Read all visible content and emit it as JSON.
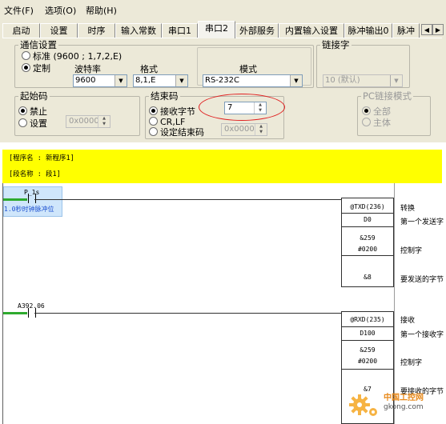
{
  "menubar": {
    "items": [
      "文件(F)",
      "选项(O)",
      "帮助(H)"
    ]
  },
  "tabs": [
    "启动",
    "设置",
    "时序",
    "输入常数",
    "串口1",
    "串口2",
    "外部服务",
    "内置输入设置",
    "脉冲输出0",
    "脉冲"
  ],
  "active_tab": "串口2",
  "comm": {
    "group_label": "通信设置",
    "standard_label": "标准 (9600 ; 1,7,2,E)",
    "custom_label": "定制",
    "baud_label": "波特率",
    "baud_value": "9600",
    "format_label": "格式",
    "format_value": "8,1,E",
    "mode_label": "模式",
    "mode_value": "RS-232C"
  },
  "link": {
    "group_label": "链接字",
    "value": "10 (默认)"
  },
  "start_code": {
    "group_label": "起始码",
    "disable_label": "禁止",
    "set_label": "设置",
    "value": "0x0000"
  },
  "end_code": {
    "group_label": "结束码",
    "recv_bytes_label": "接收字节",
    "recv_bytes_value": "7",
    "crlf_label": "CR,LF",
    "set_end_label": "设定结束码",
    "set_end_value": "0x0000"
  },
  "pc_link": {
    "group_label": "PC链接模式",
    "all_label": "全部",
    "master_label": "主体"
  },
  "program": {
    "name_line": "[程序名 : 新程序1]",
    "section_line": "[段名称 : 段1]"
  },
  "rung1": {
    "contact_label": "P_1s",
    "contact_comment": "1.0秒时钟脉冲位",
    "fn_name": "@TXD(236)",
    "op1": "D0",
    "op2": "&259",
    "op3": "#0200",
    "op4": "&8",
    "note_title": "转换",
    "note1": "第一个发送字",
    "note2": "控制字",
    "note3": "要发送的字节"
  },
  "rung2": {
    "contact_label": "A392.06",
    "fn_name": "@RXD(235)",
    "op1": "D100",
    "op2": "&259",
    "op3": "#0200",
    "op4": "&7",
    "note_title": "接收",
    "note1": "第一个接收字",
    "note2": "控制字",
    "note3": "要接收的字节"
  },
  "watermark": {
    "text": "中国工控网",
    "url": "gkong.com"
  }
}
